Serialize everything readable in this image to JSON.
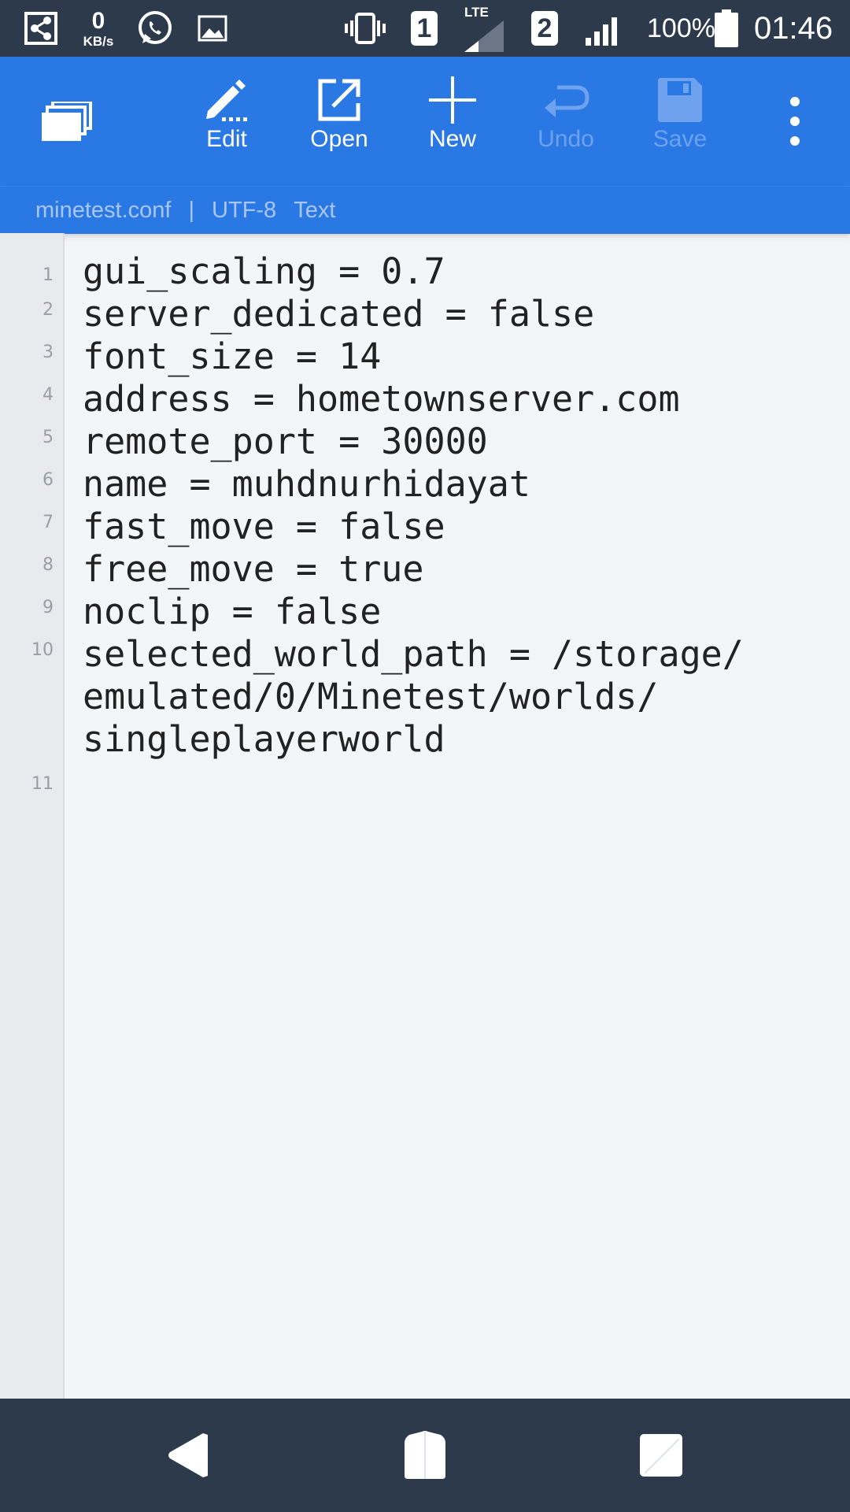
{
  "status_bar": {
    "speed_value": "0",
    "speed_unit": "KB/s",
    "sim1": "1",
    "sim2": "2",
    "network_type": "LTE",
    "battery": "100%",
    "time": "01:46"
  },
  "toolbar": {
    "edit_label": "Edit",
    "open_label": "Open",
    "new_label": "New",
    "undo_label": "Undo",
    "save_label": "Save"
  },
  "file_info": {
    "filename": "minetest.conf",
    "separator": "|",
    "encoding": "UTF-8",
    "mode": "Text"
  },
  "editor": {
    "lines": [
      {
        "num": "1",
        "text": "gui_scaling = 0.7"
      },
      {
        "num": "2",
        "text": "server_dedicated = false"
      },
      {
        "num": "3",
        "text": "font_size = 14"
      },
      {
        "num": "4",
        "text": "address = hometownserver.com"
      },
      {
        "num": "5",
        "text": "remote_port = 30000"
      },
      {
        "num": "6",
        "text": "name = muhdnurhidayat"
      },
      {
        "num": "7",
        "text": "fast_move = false"
      },
      {
        "num": "8",
        "text": "free_move = true"
      },
      {
        "num": "9",
        "text": "noclip = false"
      },
      {
        "num": "10",
        "text": "selected_world_path = /storage/",
        "wrap1": "emulated/0/Minetest/worlds/",
        "wrap2": "singleplayerworld"
      },
      {
        "num": "11",
        "text": ""
      }
    ]
  },
  "colors": {
    "toolbar": "#2a78e4",
    "status_bar": "#2c3a4b",
    "editor_bg": "#f4f5f7"
  }
}
